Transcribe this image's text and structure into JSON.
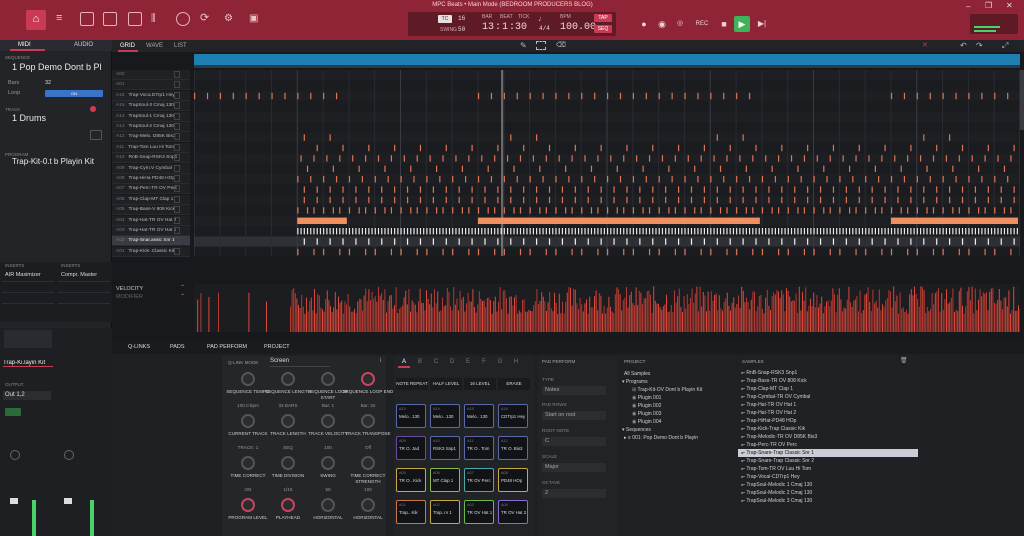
{
  "window": {
    "title": "MPC Beats • Main Mode (BEDROOM PRODUCERS BLOG)"
  },
  "transport": {
    "tc_label": "TC",
    "tc_value": "16",
    "swing_label": "SWING",
    "swing_value": "50",
    "bar_label": "BAR",
    "beat_label": "BEAT",
    "tick_label": "TICK",
    "bar": "13",
    "beat": "1",
    "tick": "30",
    "time_sig": "4/4",
    "bpm_label": "BPM",
    "bpm": "100.00",
    "tap": "TAP",
    "seq": "SEQ"
  },
  "colors": {
    "accent": "#c93a55",
    "titlebar": "#8e2435",
    "note": "#e07555",
    "note_bright": "#f09060",
    "play": "#3fb35a",
    "velocity": "#d9483a"
  },
  "left_panel": {
    "midi_tab": "MIDI",
    "audio_tab": "AUDIO",
    "sequence_header": "SEQUENCE",
    "sequence_name": "1 Pop Demo Dont b Pl",
    "bars_label": "Bars",
    "bars_value": "32",
    "loop_label": "Loop",
    "loop_value": "ON",
    "track_header": "TRACK",
    "track_name": "1 Drums",
    "program_header": "PROGRAM",
    "program_name": "Trap-Kit-0.t b Playin Kit",
    "inserts_left": "INSERTS",
    "inserts_right": "INSERTS",
    "insert_left_1": "AIR Maximizer",
    "insert_right_1": "Compr. Master",
    "mixer_name": "Trap-Ki.layin Kit",
    "output_label": "OUTPUT",
    "output_value": "Out 1,2"
  },
  "grid": {
    "tabs": [
      "GRID",
      "WAVE",
      "LIST"
    ],
    "velocity_label": "VELOCITY",
    "modifier_label": "MODIFIER",
    "tracks": [
      {
        "pad": "A02",
        "name": ""
      },
      {
        "pad": "A01",
        "name": ""
      },
      {
        "pad": "A16",
        "name": "Trap-Voca.D7rp1 Hey"
      },
      {
        "pad": "A15",
        "name": "TrapSoul-3 Cmaj 130"
      },
      {
        "pad": "A14",
        "name": "TrapSoul-1 Cmaj 130"
      },
      {
        "pad": "A13",
        "name": "TrapSoul-2 Cmaj 130"
      },
      {
        "pad": "A12",
        "name": "Trap-Melo. D85K Bis3"
      },
      {
        "pad": "A11",
        "name": "Trap-Tom Luu Hi Tom"
      },
      {
        "pad": "A10",
        "name": "RnB-Snap-RSK3 Snp1"
      },
      {
        "pad": "A09",
        "name": "Trap-Cym.V Cymbal"
      },
      {
        "pad": "A08",
        "name": "Trap-HiHa PD48 HOp"
      },
      {
        "pad": "A07",
        "name": "Trap-Perc-TR OV Perc"
      },
      {
        "pad": "A06",
        "name": "Trap-Clap-MT Clap 1"
      },
      {
        "pad": "A05",
        "name": "Trap-Bass-V 808 Kick"
      },
      {
        "pad": "A04",
        "name": "Trap-Hat-TR OV Hat 2"
      },
      {
        "pad": "A03",
        "name": "Trap-Hat-TR OV Hat 1"
      },
      {
        "pad": "A02",
        "name": "Trap-Snar.assic Snr 1"
      },
      {
        "pad": "A01",
        "name": "Trap-Kick-.Classic Kik"
      }
    ]
  },
  "bottom": {
    "tabs": [
      "Q-LINKS",
      "PADS",
      "PAD PERFORM",
      "PROJECT"
    ],
    "qlink_mode_label": "Q-LINK MODE",
    "qlink_mode": "Screen",
    "knobs": [
      {
        "label": "SEQUENCE TEMPO",
        "value": "100.0 bpm"
      },
      {
        "label": "SEQUENCE LENGTH",
        "value": "32 BARS"
      },
      {
        "label": "SEQUENCE LOOP START",
        "value": "Bar: 1"
      },
      {
        "label": "SEQUENCE LOOP END",
        "value": "Bar: 32"
      },
      {
        "label": "CURRENT TRACK",
        "value": "TRACK: 1"
      },
      {
        "label": "TRACK LENGTH",
        "value": "SEQ"
      },
      {
        "label": "TRACK VELOCITY",
        "value": "100"
      },
      {
        "label": "TRACK TRANSPOSE",
        "value": "Off"
      },
      {
        "label": "TIME CORRECT",
        "value": "ON"
      },
      {
        "label": "TIME DIVISION",
        "value": "1/16"
      },
      {
        "label": "SWING",
        "value": "50"
      },
      {
        "label": "TIME CORRECT STRENGTH",
        "value": "100"
      },
      {
        "label": "PROGRAM LEVEL",
        "value": ""
      },
      {
        "label": "PLAYHEAD",
        "value": ""
      },
      {
        "label": "HORIZONTAL",
        "value": ""
      },
      {
        "label": "HORIZONTAL",
        "value": ""
      }
    ],
    "pad_banks": [
      "A",
      "B",
      "C",
      "D",
      "E",
      "F",
      "G",
      "H"
    ],
    "pad_buttons": [
      "NOTE REPEAT",
      "HALF LEVEL",
      "16 LEVEL",
      "ERASE"
    ],
    "pads": [
      {
        "num": "A13",
        "name": "Melo.. 130"
      },
      {
        "num": "A14",
        "name": "Melo.. 130"
      },
      {
        "num": "A15",
        "name": "Melo.. 130"
      },
      {
        "num": "A16",
        "name": "CDTrp1 Hey"
      },
      {
        "num": "A09",
        "name": "TR O. Jad"
      },
      {
        "num": "A10",
        "name": "RSK3 Snp1"
      },
      {
        "num": "A11",
        "name": "TR O.. Tom"
      },
      {
        "num": "A12",
        "name": "TR O. Bis3"
      },
      {
        "num": "A05",
        "name": "TR O.. Kick"
      },
      {
        "num": "A06",
        "name": "MT Clap 1"
      },
      {
        "num": "A07",
        "name": "TR OV Perc"
      },
      {
        "num": "A08",
        "name": "PD48 HOp"
      },
      {
        "num": "A01",
        "name": "Trap.. Kik"
      },
      {
        "num": "A02",
        "name": "Trap..nr 1"
      },
      {
        "num": "A03",
        "name": "TR OV Hat 1"
      },
      {
        "num": "A04",
        "name": "TR OV Hat 2"
      }
    ],
    "pad_perform": {
      "title": "PAD PERFORM",
      "type_label": "TYPE",
      "type_value": "Notes",
      "rows_label": "PAD ROWS",
      "rows_value": "Start on root",
      "root_label": "ROOT NOTE",
      "root_value": "C",
      "scale_label": "SCALE",
      "scale_value": "Major",
      "octave_label": "OCTAVE",
      "octave_value": "2"
    },
    "project": {
      "title": "PROJECT",
      "all_samples": "All Samples",
      "programs": "Programs",
      "program_items": [
        "Trap-Kit-OV Dont b Playin Kit",
        "Plugin 001",
        "Plugin 002",
        "Plugin 003",
        "Plugin 004"
      ],
      "sequences": "Sequences",
      "sequence_item": "001: Pop Demo Dont b Playin"
    },
    "samples": {
      "title": "SAMPLES",
      "items": [
        "RnB-Snap-RSK3 Snp1",
        "Trap-Bass-TR OV 808 Kick",
        "Trap-Clap-MT Clap 1",
        "Trap-Cymbal-TR OV Cymbal",
        "Trap-Hat-TR OV Hat 1",
        "Trap-Hat-TR OV Hat 2",
        "Trap-HiHat-PD48 HOp",
        "Trap-Kick-Trap Classic Kik",
        "Trap-Melodic-TR OV D85K Bis3",
        "Trap-Perc-TR OV Perc",
        "Trap-Snare-Trap Classic Snr 1",
        "Trap-Snare-Trap Classic Snr 2",
        "Trap-Tom-TR OV Luu Hi Tom",
        "Trap-Vocal-CDTrp1 Hey",
        "TrapSoul-Melodic 1 Cmaj 130",
        "TrapSoul-Melodic 2 Cmaj 130",
        "TrapSoul-Melodic 3 Cmaj 130"
      ],
      "selected_index": 10
    }
  }
}
